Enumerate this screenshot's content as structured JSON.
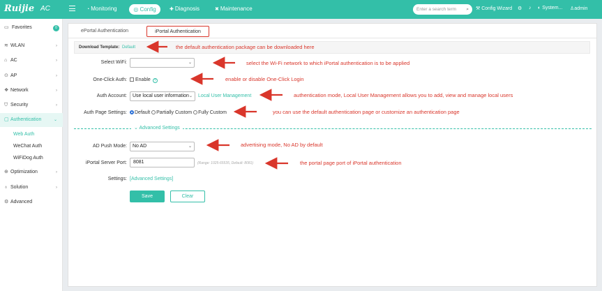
{
  "header": {
    "brand": "Ruijie",
    "brand_sub": "AC",
    "nav": [
      "Monitoring",
      "Config",
      "Diagnosis",
      "Maintenance"
    ],
    "active_nav": "Config",
    "search_placeholder": "Enter a search term",
    "config_wizard": "Config Wizard",
    "system": "System...",
    "user": "admin"
  },
  "sidebar": {
    "favorites": "Favorites",
    "favorites_badge": "0",
    "items": [
      "WLAN",
      "AC",
      "AP",
      "Network",
      "Security",
      "Authentication",
      "Optimization",
      "Solution",
      "Advanced"
    ],
    "auth_sub": [
      "Web Auth",
      "WeChat Auth",
      "WiFiDog Auth"
    ]
  },
  "tabs": [
    "ePortal Authentication",
    "iPortal Authentication"
  ],
  "form": {
    "download_label": "Download Template:",
    "download_link": "Default",
    "select_wifi_label": "Select WiFi:",
    "select_wifi_value": "",
    "one_click_label": "One-Click Auth:",
    "one_click_option": "Enable",
    "auth_account_label": "Auth Account:",
    "auth_account_value": "Use local user information",
    "local_user_link": "Local User Management",
    "auth_page_label": "Auth Page Settings:",
    "auth_page_options": [
      "Default",
      "Partially Custom",
      "Fully Custom"
    ],
    "advanced_toggle": "Advanced Settings",
    "ad_push_label": "AD Push Mode:",
    "ad_push_value": "No AD",
    "server_port_label": "iPortal Server Port:",
    "server_port_value": "8081",
    "server_port_hint": "(Range: 1025-65535, Default: 8081)",
    "settings_label": "Settings:",
    "settings_link": "[Advanced Settings]",
    "save": "Save",
    "clear": "Clear"
  },
  "annotations": [
    "the default authentication package can be downloaded here",
    "select the Wi-Fi network to which iPortal authentication is to be applied",
    "enable or disable One-Click Login",
    "authentication mode, Local User Management allows you to add, view and manage local users",
    "you can use the default authentication page or customize an authentication page",
    "advertising mode, No AD by default",
    "the portal page port of iPortal authentication"
  ]
}
